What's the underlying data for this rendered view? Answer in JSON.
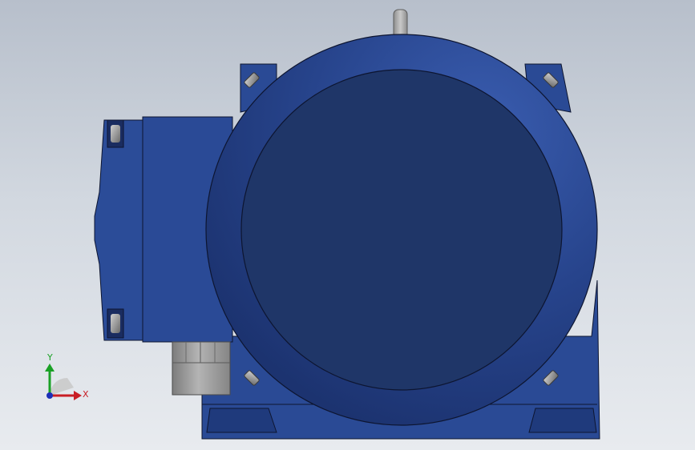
{
  "viewport": {
    "background_top": "#b7bfcb",
    "background_bottom": "#e8ebef"
  },
  "model": {
    "primary_color": "#25418a",
    "face_color": "#1f3668",
    "shaft_color": "#a8a8a8",
    "fitting_color": "#9a9a9a",
    "edge_color": "#0d1530"
  },
  "triad": {
    "x_label": "X",
    "y_label": "Y",
    "x_color": "#c81d25",
    "y_color": "#1aa126",
    "z_color": "#1c2fb8"
  }
}
